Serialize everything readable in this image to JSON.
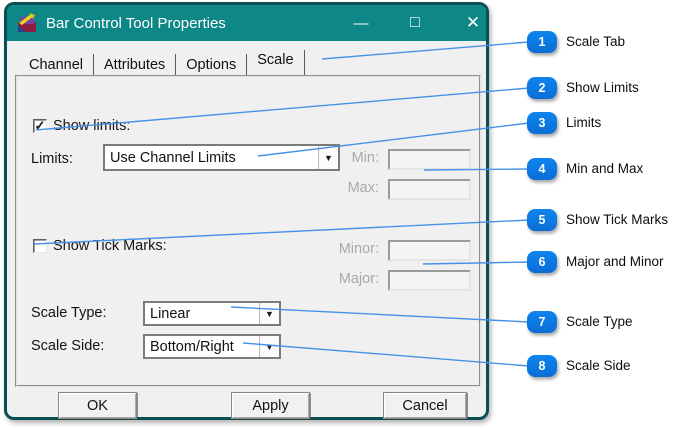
{
  "window": {
    "title": "Bar Control Tool Properties"
  },
  "icons": {
    "minimize": "—",
    "maximize": "□",
    "close": "✕",
    "dropdown_arrow": "▼",
    "check": "✓"
  },
  "tabs": [
    {
      "label": "Channel",
      "active": false
    },
    {
      "label": "Attributes",
      "active": false
    },
    {
      "label": "Options",
      "active": false
    },
    {
      "label": "Scale",
      "active": true
    }
  ],
  "panel": {
    "show_limits": {
      "label": "Show limits:",
      "checked": true
    },
    "limits": {
      "label": "Limits:",
      "selected": "Use Channel Limits"
    },
    "min": {
      "label": "Min:",
      "value": "",
      "disabled": true
    },
    "max": {
      "label": "Max:",
      "value": "",
      "disabled": true
    },
    "show_tick_marks": {
      "label": "Show Tick Marks:",
      "checked": false
    },
    "minor": {
      "label": "Minor:",
      "value": "",
      "disabled": true
    },
    "major": {
      "label": "Major:",
      "value": "",
      "disabled": true
    },
    "scale_type": {
      "label": "Scale Type:",
      "selected": "Linear"
    },
    "scale_side": {
      "label": "Scale Side:",
      "selected": "Bottom/Right"
    }
  },
  "buttons": [
    {
      "label": "OK"
    },
    {
      "label": "Apply"
    },
    {
      "label": "Cancel"
    }
  ],
  "callouts": [
    {
      "num": "1",
      "label": "Scale Tab"
    },
    {
      "num": "2",
      "label": "Show Limits"
    },
    {
      "num": "3",
      "label": "Limits"
    },
    {
      "num": "4",
      "label": "Min and Max"
    },
    {
      "num": "5",
      "label": "Show Tick Marks"
    },
    {
      "num": "6",
      "label": "Major and Minor"
    },
    {
      "num": "7",
      "label": "Scale Type"
    },
    {
      "num": "8",
      "label": "Scale Side"
    }
  ],
  "colors": {
    "titlebar": "#0e8787",
    "dialog_border": "#0a5052",
    "callout": "#0f84ef",
    "connector_line": "#4792e8"
  }
}
